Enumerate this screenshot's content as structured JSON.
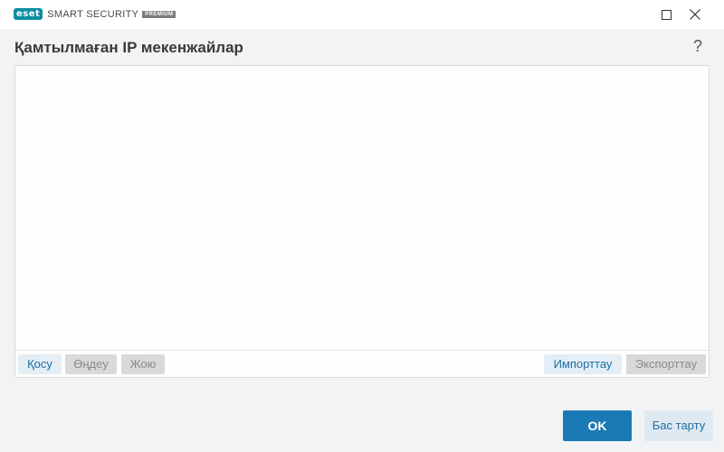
{
  "app": {
    "logo_brand": "eset",
    "product_name": "SMART SECURITY",
    "edition_badge": "PREMIUM"
  },
  "window_controls": {
    "maximize_icon": "maximize-icon",
    "close_icon": "close-icon"
  },
  "header": {
    "title": "Қамтылмаған IP мекенжайлар",
    "help_symbol": "?"
  },
  "list_toolbar": {
    "add_label": "Қосу",
    "edit_label": "Өңдеу",
    "delete_label": "Жою",
    "import_label": "Импорттау",
    "export_label": "Экспорттау"
  },
  "footer": {
    "ok_label": "OK",
    "cancel_label": "Бас тарту"
  },
  "colors": {
    "brand_teal": "#0c8ea0",
    "primary_blue": "#1a7ab5",
    "link_blue": "#1d6ea3",
    "background": "#f2f3f5"
  }
}
